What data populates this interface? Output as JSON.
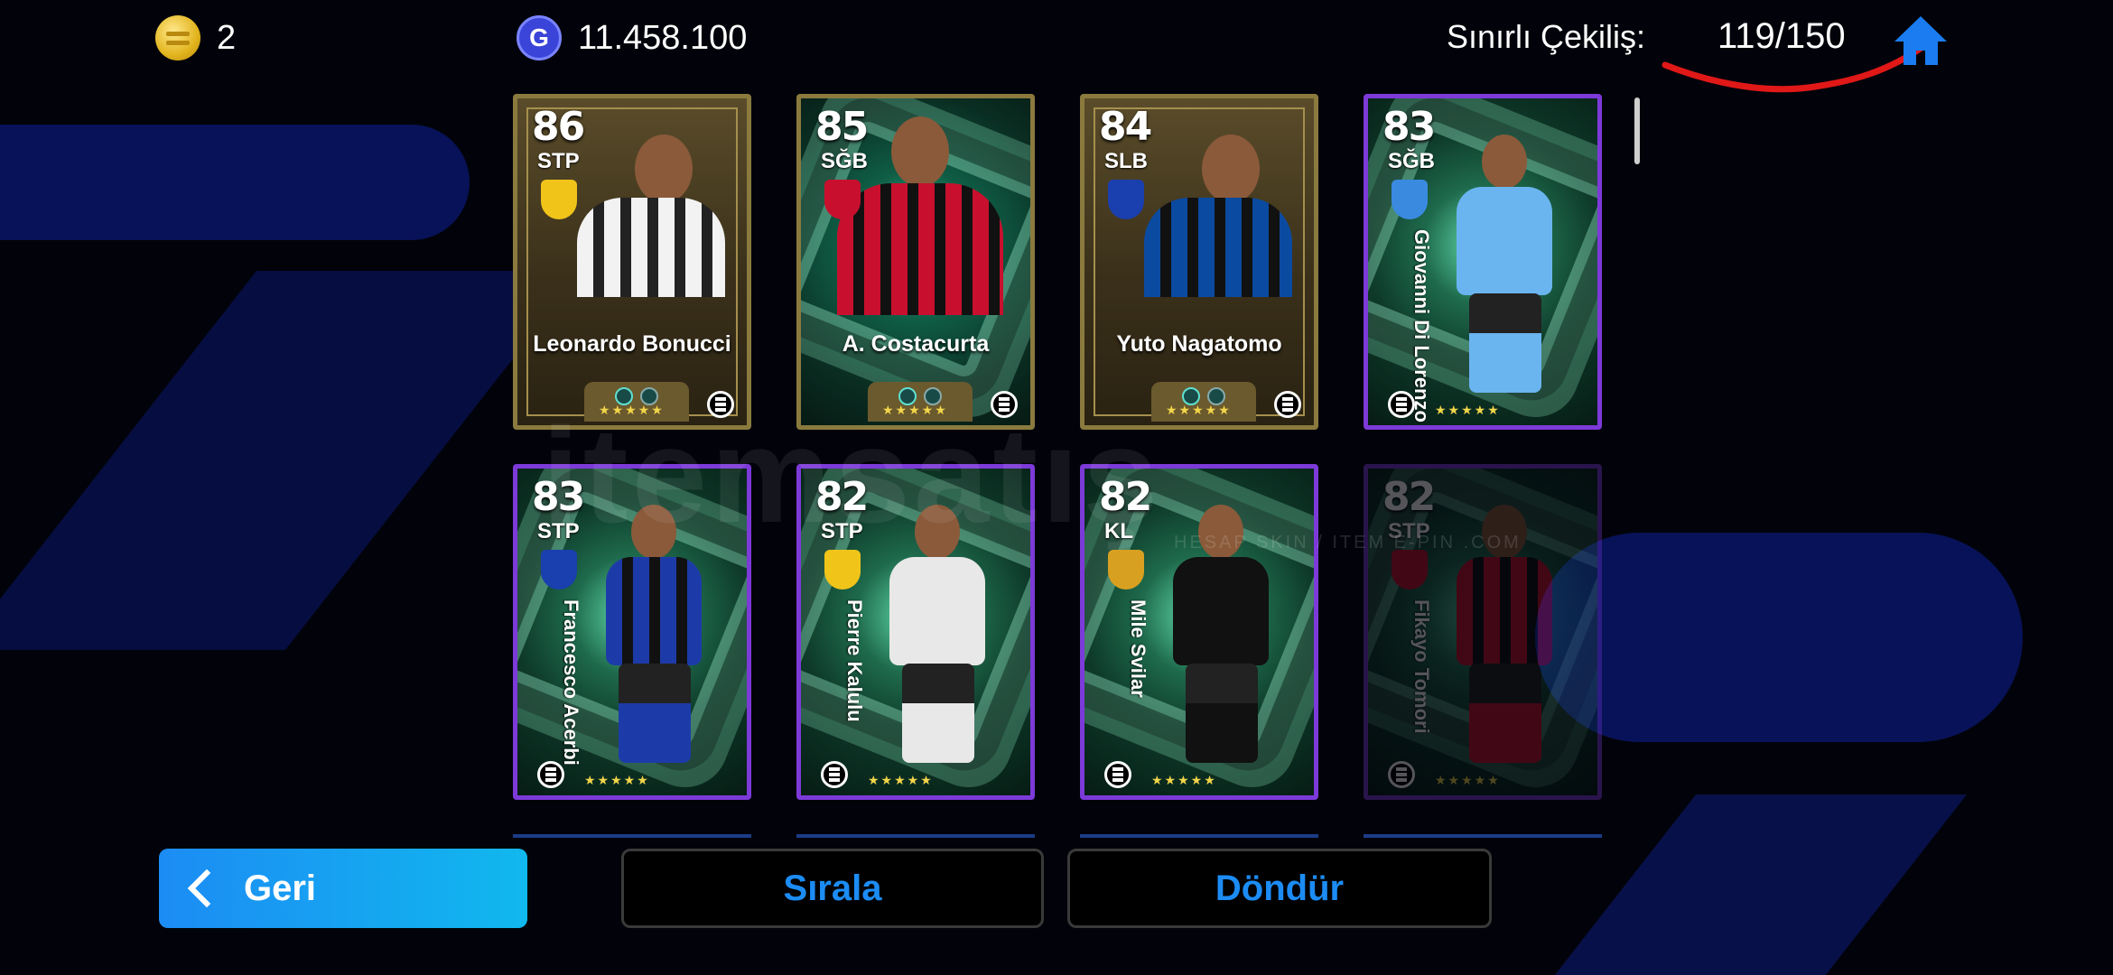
{
  "top_bar": {
    "coins": "2",
    "gp": "11.458.100",
    "gp_icon_letter": "G",
    "pull_label": "Sınırlı Çekiliş:",
    "pull_count": "119/150",
    "icons": {
      "coin": "coin-icon",
      "gp": "gp-icon",
      "home": "home-icon"
    }
  },
  "cards": [
    {
      "rating": "86",
      "position": "STP",
      "name": "Leonardo Bonucci",
      "style": "gold",
      "stars": "★★★★★"
    },
    {
      "rating": "85",
      "position": "SĞB",
      "name": "A. Costacurta",
      "style": "green",
      "stars": "★★★★★"
    },
    {
      "rating": "84",
      "position": "SLB",
      "name": "Yuto Nagatomo",
      "style": "gold",
      "stars": "★★★★★"
    },
    {
      "rating": "83",
      "position": "SĞB",
      "name": "Giovanni Di Lorenzo",
      "style": "blue",
      "stars": "★★★★★"
    },
    {
      "rating": "83",
      "position": "STP",
      "name": "Francesco Acerbi",
      "style": "blue",
      "stars": "★★★★★"
    },
    {
      "rating": "82",
      "position": "STP",
      "name": "Pierre Kalulu",
      "style": "blue",
      "stars": "★★★★★"
    },
    {
      "rating": "82",
      "position": "KL",
      "name": "Mile Svilar",
      "style": "blue",
      "stars": "★★★★★"
    },
    {
      "rating": "82",
      "position": "STP",
      "name": "Fikayo Tomori",
      "style": "blue",
      "stars": "★★★★★"
    }
  ],
  "buttons": {
    "back": "Geri",
    "sort": "Sırala",
    "rotate": "Döndür"
  },
  "watermark": {
    "main": "itemsatış",
    "sub": "HESAP SKIN / ITEM E-PIN .COM"
  },
  "colors": {
    "accent": "#1c8cf4",
    "annotation_red": "#e01818",
    "card_border_blue": "#7c3ad8",
    "card_border_gold": "#8a7a3e"
  }
}
